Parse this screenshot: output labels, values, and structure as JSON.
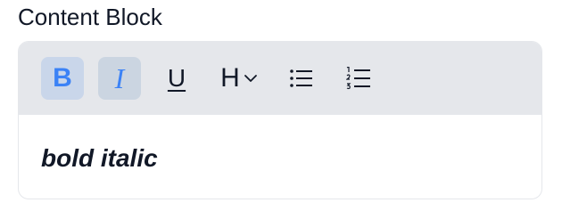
{
  "field": {
    "label": "Content Block"
  },
  "toolbar": {
    "bold": {
      "glyph": "B",
      "active": true,
      "icon": "bold-icon"
    },
    "italic": {
      "glyph": "I",
      "active": true,
      "icon": "italic-icon"
    },
    "underline": {
      "glyph": "U",
      "active": false,
      "icon": "underline-icon"
    },
    "heading": {
      "glyph": "H",
      "active": false,
      "icon": "heading-icon"
    },
    "bullet_list": {
      "icon": "bullet-list-icon"
    },
    "numbered_list": {
      "icon": "numbered-list-icon"
    }
  },
  "editor": {
    "content": "bold italic"
  },
  "colors": {
    "accent": "#3b82f6",
    "toolbar_bg": "#e5e7eb",
    "active_bg": "#cbd5e1",
    "text": "#111827"
  }
}
